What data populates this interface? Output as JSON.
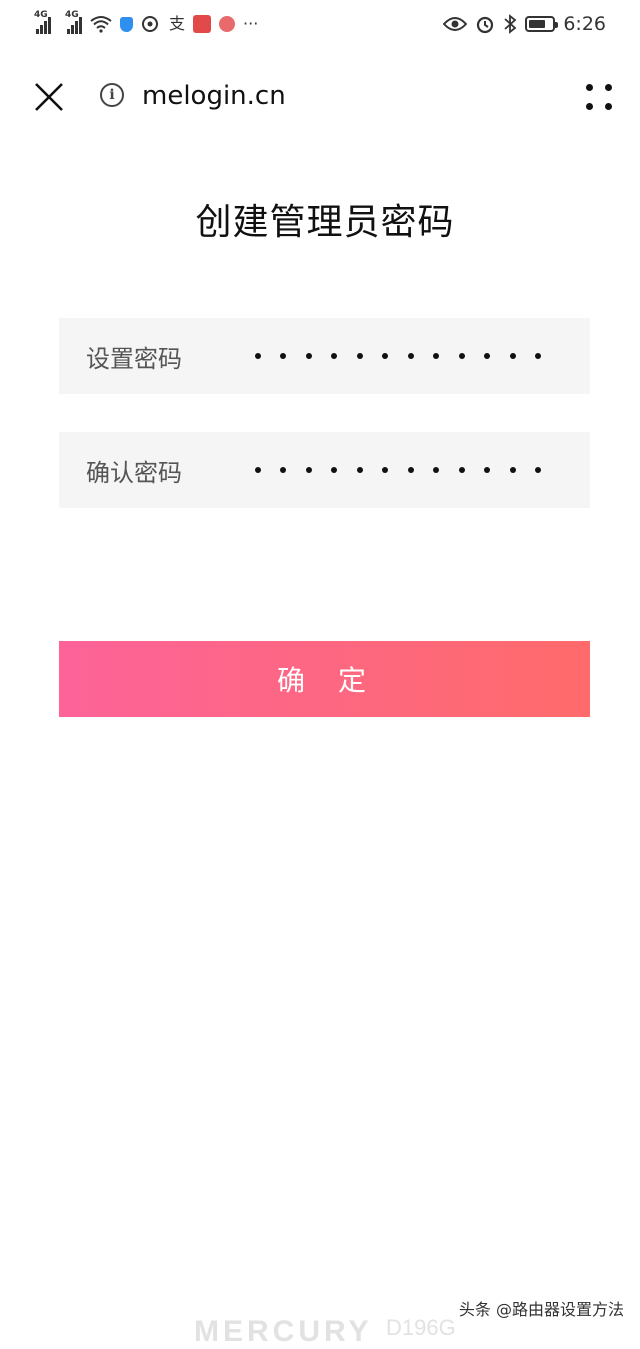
{
  "status_bar": {
    "signal1_tag": "4G",
    "signal2_tag": "4G",
    "alipay_icon_text": "支",
    "more_text": "···",
    "time": "6:26"
  },
  "browser": {
    "url": "melogin.cn"
  },
  "page": {
    "title": "创建管理员密码",
    "fields": [
      {
        "label": "设置密码",
        "masked_length": 12
      },
      {
        "label": "确认密码",
        "masked_length": 12
      }
    ],
    "confirm_button": "确 定"
  },
  "footer": {
    "watermark": "头条 @路由器设置方法",
    "brand": "MERCURY",
    "model": "D196G"
  },
  "colors": {
    "button_gradient_start": "#fd6399",
    "button_gradient_end": "#ff6b6b",
    "field_background": "#f5f5f5"
  }
}
